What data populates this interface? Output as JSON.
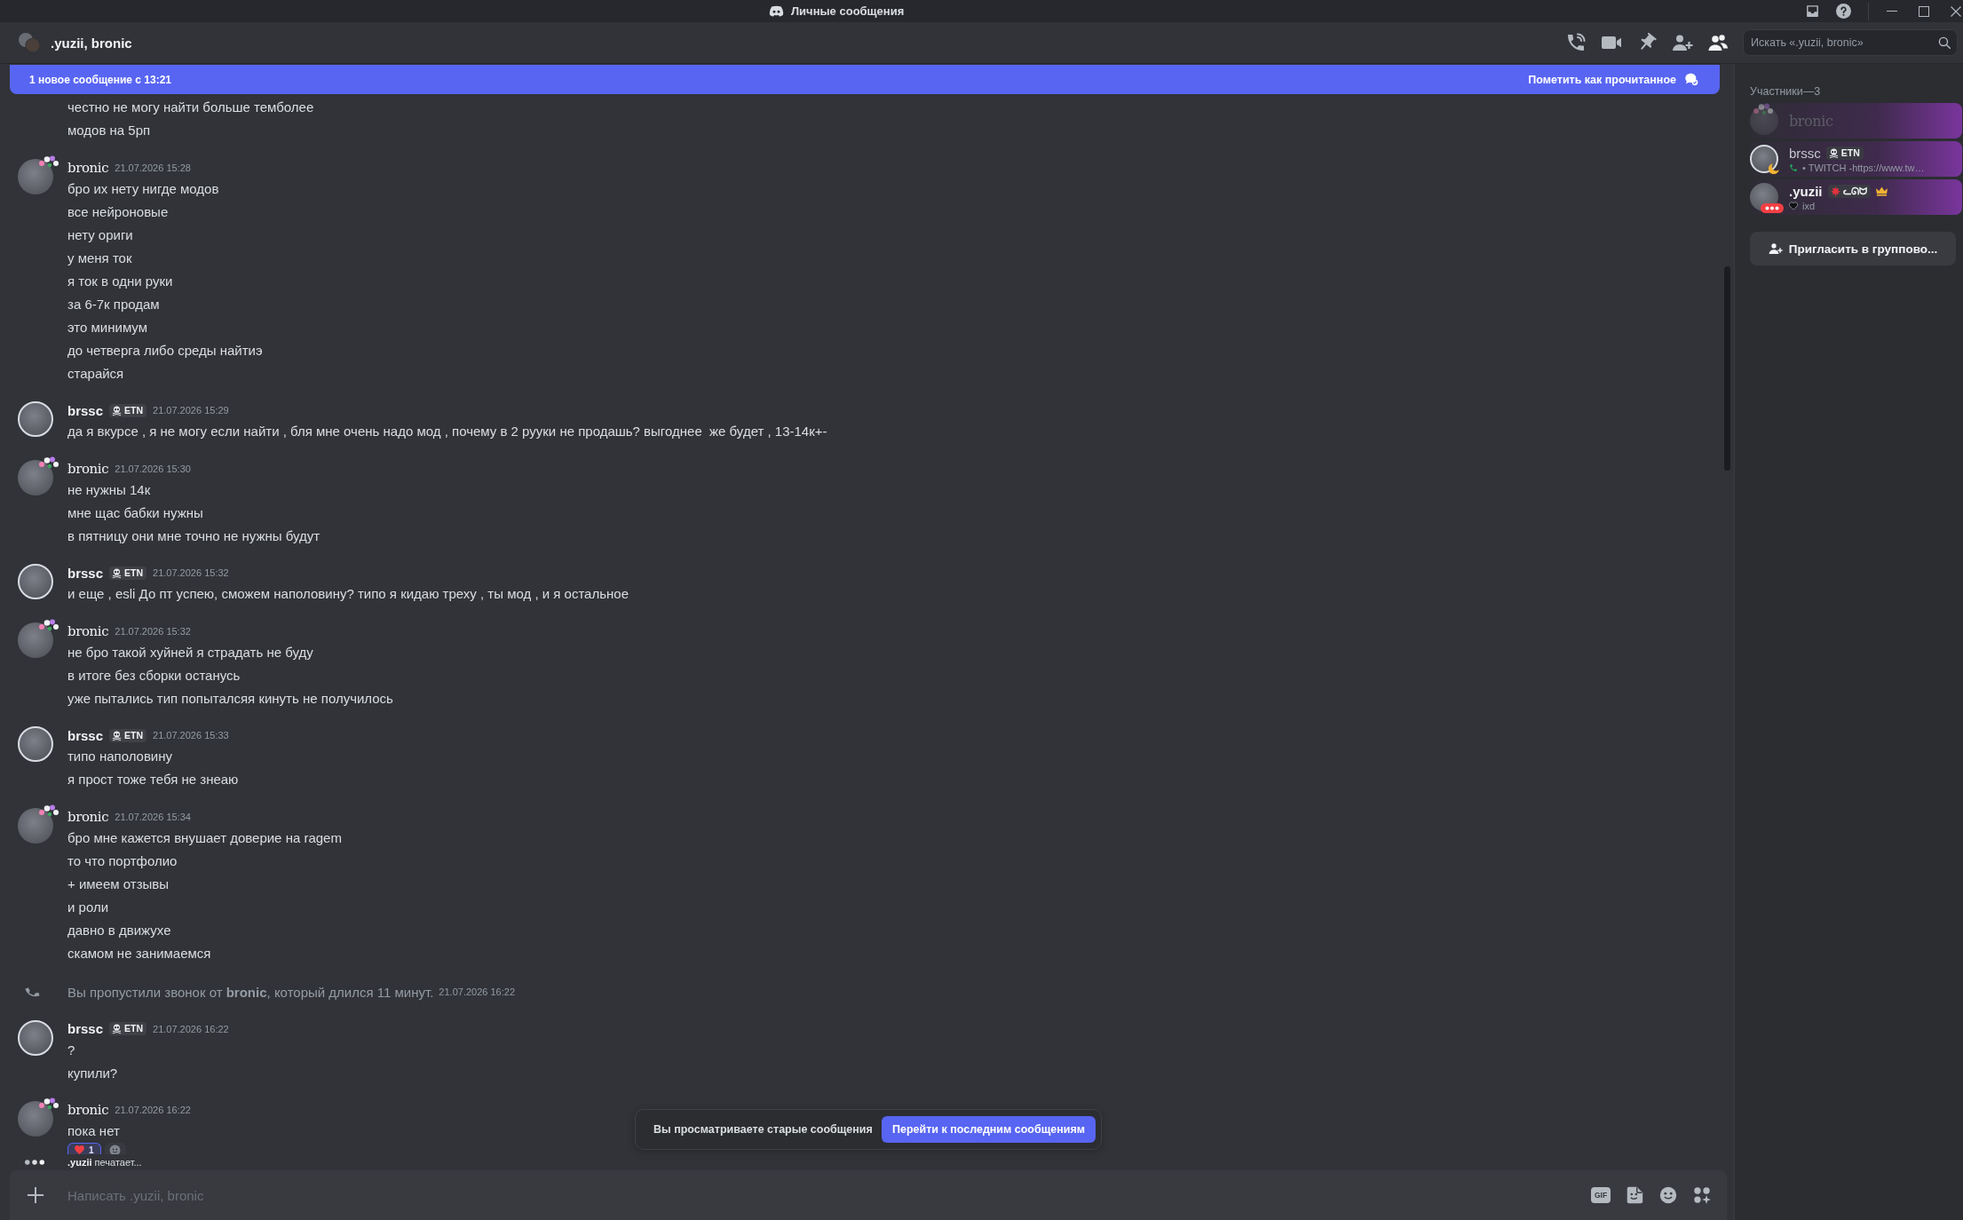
{
  "window": {
    "title": "Личные сообщения"
  },
  "header": {
    "title": ".yuzii, bronic",
    "toolbar": [
      {
        "kind": "call",
        "selected": false
      },
      {
        "kind": "video",
        "selected": false
      },
      {
        "kind": "pin",
        "selected": false
      },
      {
        "kind": "add_member",
        "selected": false
      },
      {
        "kind": "members",
        "selected": true
      }
    ],
    "search": {
      "placeholder": "Искать «.yuzii, bronic»"
    }
  },
  "new_messages_bar": {
    "text": "1 новое сообщение с 13:21",
    "action": "Пометить как прочитанное"
  },
  "messages": [
    {
      "kind": "continuation",
      "lines": [
        "честно не могу найти больше темболее",
        "модов на 5рп"
      ]
    },
    {
      "kind": "group",
      "author": {
        "kind": "fancy",
        "name": "bronic"
      },
      "timestamp": "21.07.2026 15:28",
      "lines": [
        "бро их нету нигде модов",
        "все нейроновые",
        "нету ориги",
        "у меня ток",
        "я ток в одни руки",
        "за 6-7к продам",
        "это минимум",
        "до четверга либо среды найтиэ",
        "старайся"
      ]
    },
    {
      "kind": "group",
      "author": {
        "kind": "plain",
        "name": "brssc"
      },
      "tag": {
        "kind": "skull",
        "label": "ETN"
      },
      "timestamp": "21.07.2026 15:29",
      "lines": [
        "да я вкурсе , я не могу если найти , бля мне очень надо мод , почему в 2 рууки не продашь? выгоднее  же будет , 13-14к+-"
      ]
    },
    {
      "kind": "group",
      "author": {
        "kind": "fancy",
        "name": "bronic"
      },
      "timestamp": "21.07.2026 15:30",
      "lines": [
        "не нужны 14к",
        "мне щас бабки нужны",
        "в пятницу они мне точно не нужны будут"
      ]
    },
    {
      "kind": "group",
      "author": {
        "kind": "plain",
        "name": "brssc"
      },
      "tag": {
        "kind": "skull",
        "label": "ETN"
      },
      "timestamp": "21.07.2026 15:32",
      "lines": [
        "и еще , esli До пт успею, сможем наполовину? типо я кидаю треху , ты мод , и я остальное"
      ]
    },
    {
      "kind": "group",
      "author": {
        "kind": "fancy",
        "name": "bronic"
      },
      "timestamp": "21.07.2026 15:32",
      "lines": [
        "не бро такой хуйней я страдать не буду",
        "в итоге без сборки останусь",
        "уже пытались тип попыталсяя кинуть не получилось"
      ]
    },
    {
      "kind": "group",
      "author": {
        "kind": "plain",
        "name": "brssc"
      },
      "tag": {
        "kind": "skull",
        "label": "ETN"
      },
      "timestamp": "21.07.2026 15:33",
      "lines": [
        "типо наполовину",
        "я прост тоже тебя не знеаю"
      ]
    },
    {
      "kind": "group",
      "author": {
        "kind": "fancy",
        "name": "bronic"
      },
      "timestamp": "21.07.2026 15:34",
      "lines": [
        "бро мне кажется внушает доверие на ragem",
        "то что портфолио",
        "+ имеем отзывы",
        "и роли",
        "давно в движухе",
        "скамом не занимаемся"
      ]
    },
    {
      "kind": "missed_call",
      "text": "Вы пропустили звонок от **bronic**, который длился 11 минут.",
      "timestamp": "21.07.2026 16:22"
    },
    {
      "kind": "group",
      "author": {
        "kind": "plain",
        "name": "brssc"
      },
      "tag": {
        "kind": "skull",
        "label": "ETN"
      },
      "timestamp": "21.07.2026 16:22",
      "lines": [
        "?",
        "купили?"
      ]
    },
    {
      "kind": "group",
      "author": {
        "kind": "fancy",
        "name": "bronic"
      },
      "timestamp": "21.07.2026 16:22",
      "lines": [
        "пока нет"
      ],
      "reactions": [
        {
          "count": "1"
        }
      ]
    }
  ],
  "typing": {
    "user": ".yuzii",
    "text": "печатает..."
  },
  "jump_bar": {
    "text": "Вы просматриваете старые сообщения",
    "button": "Перейти к последним сообщениям"
  },
  "composer": {
    "placeholder": "Написать .yuzii, bronic",
    "buttons": [
      {
        "kind": "gif",
        "label": "GIF"
      },
      {
        "kind": "sticker"
      },
      {
        "kind": "emoji"
      },
      {
        "kind": "apps"
      }
    ]
  },
  "members": {
    "title": "Участники—3",
    "items": [
      {
        "kind": "fancy",
        "name": "bronic",
        "offline": true
      },
      {
        "kind": "plain",
        "name": "brssc",
        "offline": false,
        "status": {
          "kind": "idle",
          "color": "#f0b232"
        },
        "tag": {
          "kind": "skull",
          "label": "ETN"
        },
        "activity": {
          "kind": "voice",
          "text": "• TWITCH -https://www.tw…"
        }
      },
      {
        "kind": "bold",
        "name": ".yuzii",
        "offline": false,
        "status": {
          "kind": "typing",
          "color": "#f23f43"
        },
        "tag": {
          "kind": "leaf",
          "label": "ᓚᘏᗢ"
        },
        "owner": true,
        "activity": {
          "kind": "custom",
          "text": "ixd"
        }
      }
    ],
    "invite_button": "Пригласить в группово..."
  }
}
